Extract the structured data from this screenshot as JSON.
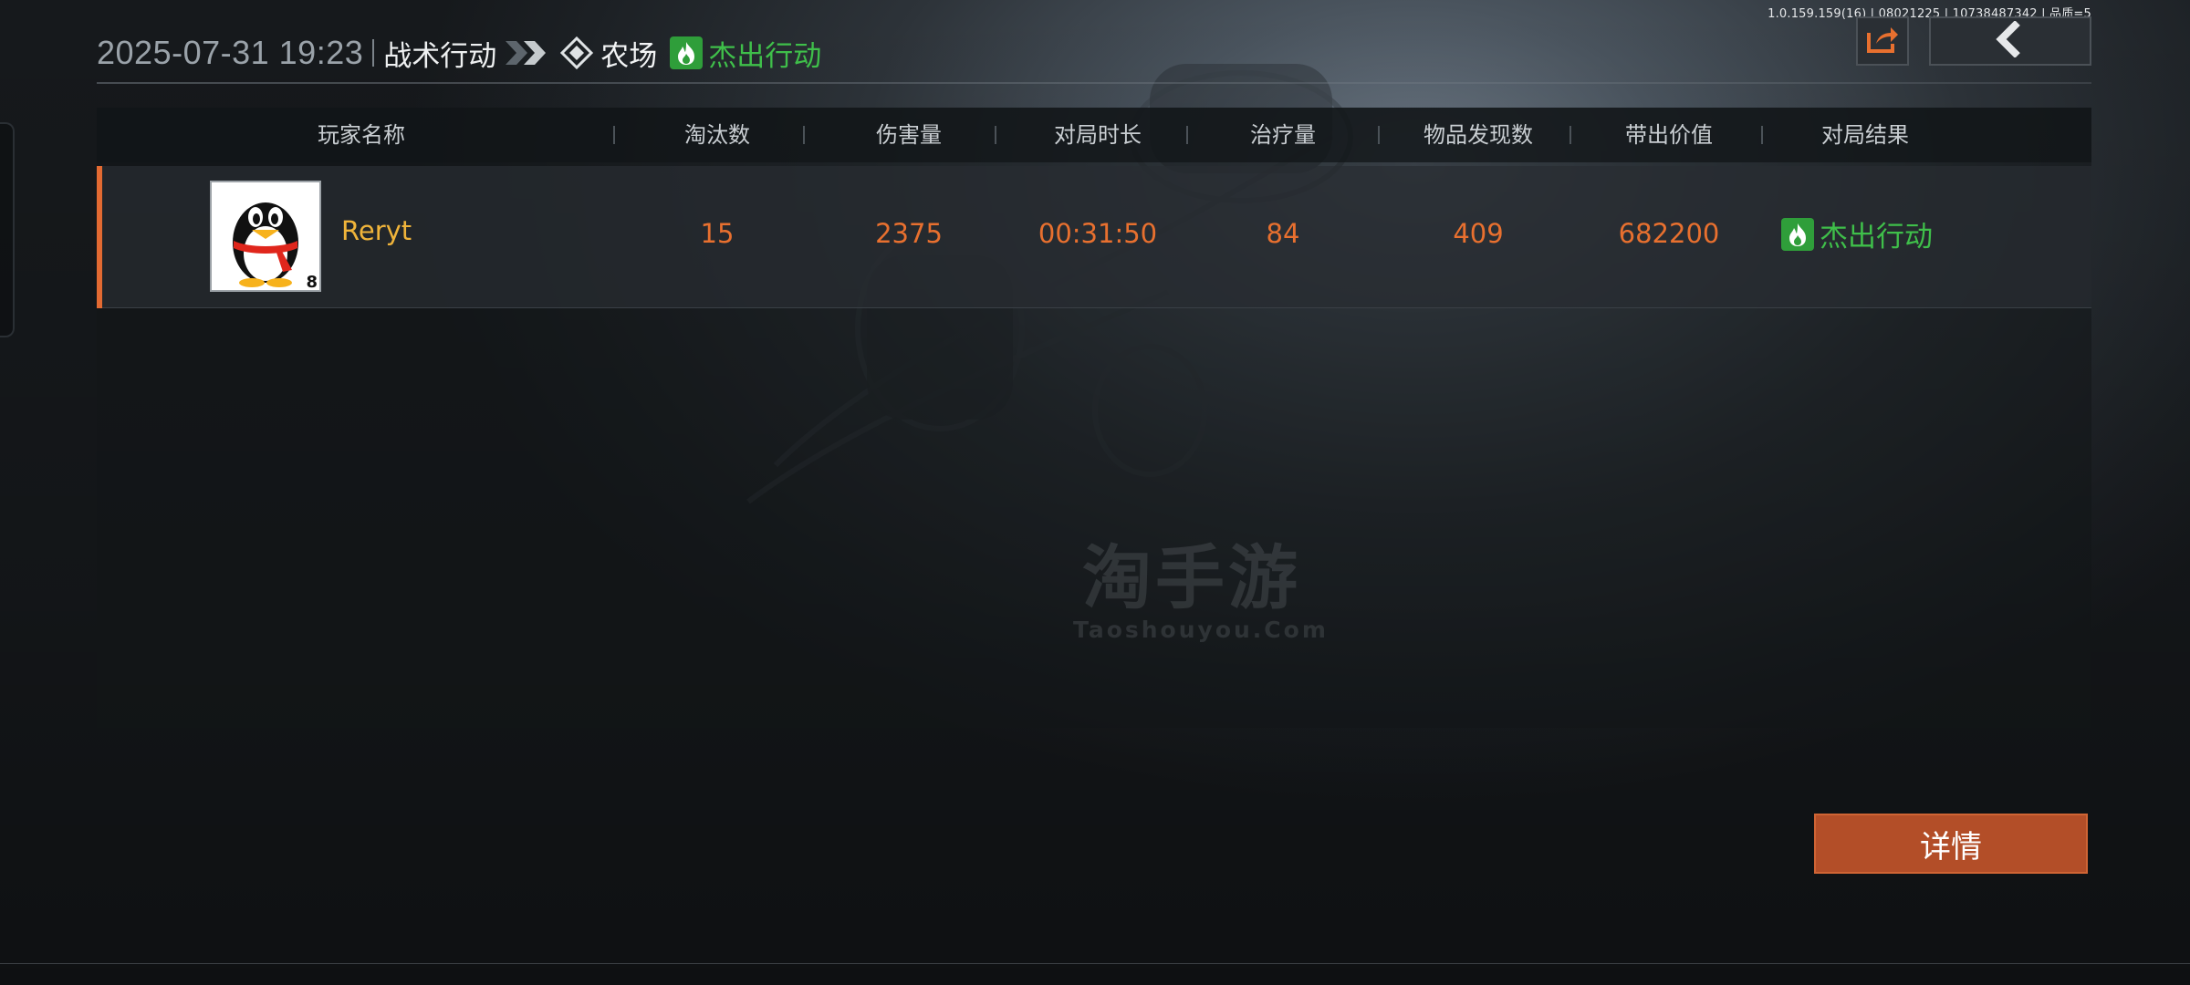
{
  "version_info": "1.0.159.159(16) | 08021225 | 10738487342 | 品质=5",
  "header": {
    "datetime": "2025-07-31 19:23",
    "mode": "战术行动",
    "map": "农场",
    "result": "杰出行动"
  },
  "table": {
    "columns": [
      "玩家名称",
      "淘汰数",
      "伤害量",
      "对局时长",
      "治疗量",
      "物品发现数",
      "带出价值",
      "对局结果"
    ],
    "rows": [
      {
        "player_name": "Reryt",
        "level": "8",
        "eliminations": "15",
        "damage": "2375",
        "duration": "00:31:50",
        "healing": "84",
        "items_found": "409",
        "extract_value": "682200",
        "result": "杰出行动"
      }
    ]
  },
  "watermark": {
    "cn": "淘手游",
    "en": "Taoshouyou.Com"
  },
  "details_button": "详情",
  "colors": {
    "accent_orange": "#e8702f",
    "name_gold": "#f0b43a",
    "success_green": "#3fbf4a",
    "button_orange": "#b34e28"
  },
  "icons": [
    "share-icon",
    "back-chevron-icon",
    "map-diamond-icon",
    "double-chevron-icon",
    "flame-icon",
    "qq-penguin-avatar"
  ]
}
